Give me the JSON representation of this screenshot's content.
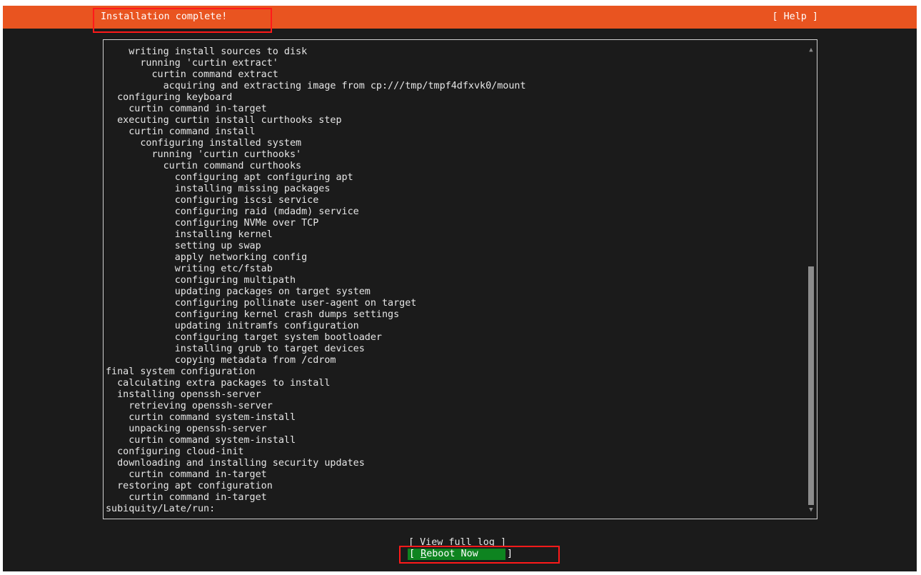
{
  "header": {
    "title": "Installation complete!",
    "help_label": "[ Help ]"
  },
  "log": {
    "lines": [
      "    writing install sources to disk",
      "      running 'curtin extract'",
      "        curtin command extract",
      "          acquiring and extracting image from cp:///tmp/tmpf4dfxvk0/mount",
      "  configuring keyboard",
      "    curtin command in-target",
      "  executing curtin install curthooks step",
      "    curtin command install",
      "      configuring installed system",
      "        running 'curtin curthooks'",
      "          curtin command curthooks",
      "            configuring apt configuring apt",
      "            installing missing packages",
      "            configuring iscsi service",
      "            configuring raid (mdadm) service",
      "            configuring NVMe over TCP",
      "            installing kernel",
      "            setting up swap",
      "            apply networking config",
      "            writing etc/fstab",
      "            configuring multipath",
      "            updating packages on target system",
      "            configuring pollinate user-agent on target",
      "            configuring kernel crash dumps settings",
      "            updating initramfs configuration",
      "            configuring target system bootloader",
      "            installing grub to target devices",
      "            copying metadata from /cdrom",
      "final system configuration",
      "  calculating extra packages to install",
      "  installing openssh-server",
      "    retrieving openssh-server",
      "    curtin command system-install",
      "    unpacking openssh-server",
      "    curtin command system-install",
      "  configuring cloud-init",
      "  downloading and installing security updates",
      "    curtin command in-target",
      "  restoring apt configuration",
      "    curtin command in-target",
      "subiquity/Late/run:"
    ]
  },
  "scrollbar": {
    "up_arrow": "▲",
    "down_arrow": "▼",
    "position_percent": 47
  },
  "buttons": {
    "view_log": "[ View full log ]",
    "reboot_open": "[ ",
    "reboot_hotkey": "R",
    "reboot_rest": "eboot Now     ]"
  },
  "colors": {
    "header_bg": "#e95420",
    "screen_bg": "#1b1b1b",
    "reboot_bg": "#0e8420",
    "annotation": "#ff1a1a"
  }
}
